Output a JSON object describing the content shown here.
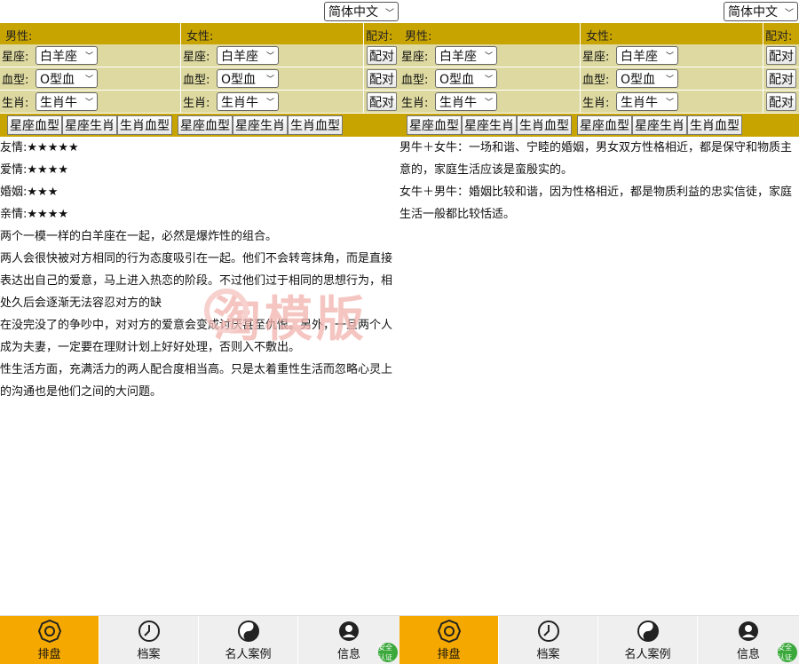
{
  "language": {
    "selected": "简体中文"
  },
  "form": {
    "male_header": "男性:",
    "female_header": "女性:",
    "match_header": "配对:",
    "rows": [
      {
        "label_male": "星座:",
        "value_male": "白羊座",
        "label_female": "星座:",
        "value_female": "白羊座",
        "button": "配对"
      },
      {
        "label_male": "血型:",
        "value_male": "O型血",
        "label_female": "血型:",
        "value_female": "O型血",
        "button": "配对"
      },
      {
        "label_male": "生肖:",
        "value_male": "生肖牛",
        "label_female": "生肖:",
        "value_female": "生肖牛",
        "button": "配对"
      }
    ],
    "tabs": [
      "星座血型",
      "星座生肖",
      "生肖血型"
    ]
  },
  "left_result": {
    "ratings": [
      {
        "label": "友情:",
        "stars": "★★★★★"
      },
      {
        "label": "爱情:",
        "stars": "★★★★"
      },
      {
        "label": "婚姻:",
        "stars": "★★★"
      },
      {
        "label": "亲情:",
        "stars": "★★★★"
      }
    ],
    "paragraphs": [
      "两个一模一样的白羊座在一起，必然是爆炸性的组合。",
      "两人会很快被对方相同的行为态度吸引在一起。他们不会转弯抹角，而是直接表达出自己的爱意，马上进入热恋的阶段。不过他们过于相同的思想行为，相处久后会逐渐无法容忍对方的缺",
      "在没完没了的争吵中，对对方的爱意会变成讨厌甚至仇恨。另外，一旦两个人成为夫妻，一定要在理财计划上好好处理，否则入不敷出。",
      "性生活方面，充满活力的两人配合度相当高。只是太着重性生活而忽略心灵上的沟通也是他们之间的大问题。"
    ]
  },
  "right_result": {
    "paragraphs": [
      "男牛＋女牛：一场和谐、宁睦的婚姻，男女双方性格相近，都是保守和物质主意的，家庭生活应该是蛮殷实的。",
      "女牛＋男牛：婚姻比较和谐，因为性格相近，都是物质利益的忠实信徒，家庭生活一般都比较恬适。"
    ]
  },
  "watermark": "淘模版",
  "nav": [
    {
      "label": "排盘",
      "icon": "bagua-icon"
    },
    {
      "label": "档案",
      "icon": "clock-icon"
    },
    {
      "label": "名人案例",
      "icon": "yinyang-icon"
    },
    {
      "label": "信息",
      "icon": "user-icon"
    }
  ],
  "badge": "安全认证",
  "colors": {
    "header": "#c8a400",
    "row": "#ddd9a0",
    "nav_active": "#f5a900"
  }
}
